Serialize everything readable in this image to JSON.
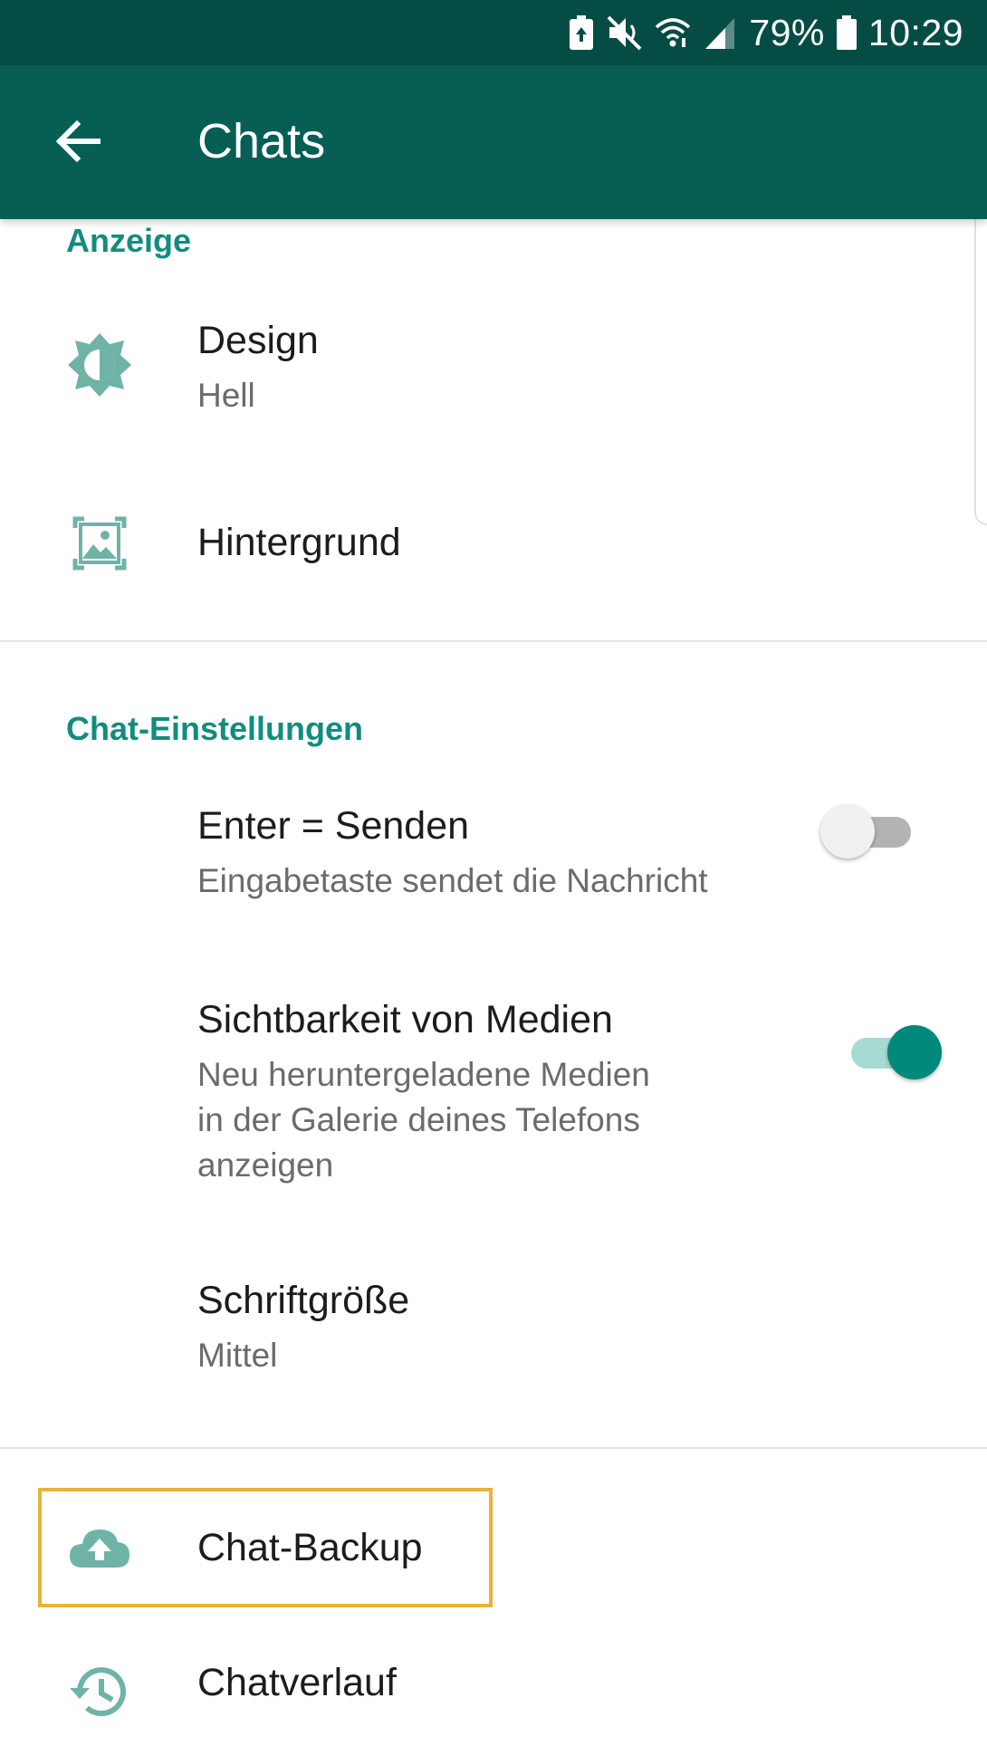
{
  "status_bar": {
    "battery_percent": "79%",
    "time": "10:29",
    "icons": [
      "battery-saver-icon",
      "mute-icon",
      "wifi-icon",
      "signal-icon",
      "battery-icon"
    ]
  },
  "app_bar": {
    "title": "Chats",
    "back_icon": "arrow-back-icon"
  },
  "colors": {
    "status_bar": "#054d44",
    "app_bar": "#075e54",
    "accent": "#128c7e",
    "switch_on": "#00897b",
    "highlight": "#e8b33a"
  },
  "sections": {
    "display": {
      "header": "Anzeige",
      "design": {
        "title": "Design",
        "value": "Hell",
        "icon": "brightness-icon"
      },
      "wallpaper": {
        "title": "Hintergrund",
        "icon": "wallpaper-icon"
      }
    },
    "chat_settings": {
      "header": "Chat-Einstellungen",
      "enter_send": {
        "title": "Enter = Senden",
        "subtitle": "Eingabetaste sendet die Nachricht",
        "enabled": false
      },
      "media_visibility": {
        "title": "Sichtbarkeit von Medien",
        "subtitle_line1": "Neu heruntergeladene Medien",
        "subtitle_line2": "in der Galerie deines Telefons",
        "subtitle_line3": "anzeigen",
        "enabled": true
      },
      "font_size": {
        "title": "Schriftgröße",
        "value": "Mittel"
      }
    },
    "other": {
      "chat_backup": {
        "title": "Chat-Backup",
        "icon": "cloud-upload-icon"
      },
      "chat_history": {
        "title": "Chatverlauf",
        "icon": "history-icon"
      }
    }
  }
}
